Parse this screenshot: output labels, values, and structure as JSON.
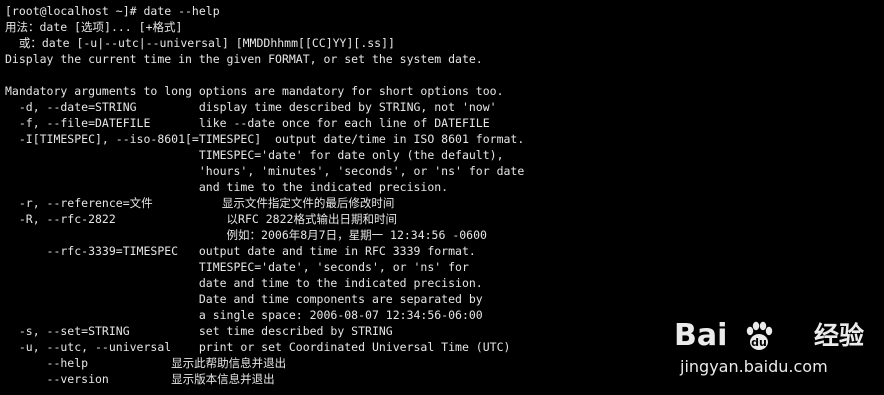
{
  "terminal": {
    "lines": [
      "[root@localhost ~]# date --help",
      "用法：date [选项]... [+格式]",
      "  或：date [-u|--utc|--universal] [MMDDhhmm[[CC]YY][.ss]]",
      "Display the current time in the given FORMAT, or set the system date.",
      "",
      "Mandatory arguments to long options are mandatory for short options too.",
      "  -d, --date=STRING         display time described by STRING, not 'now'",
      "  -f, --file=DATEFILE       like --date once for each line of DATEFILE",
      "  -I[TIMESPEC], --iso-8601[=TIMESPEC]  output date/time in ISO 8601 format.",
      "                            TIMESPEC='date' for date only (the default),",
      "                            'hours', 'minutes', 'seconds', or 'ns' for date",
      "                            and time to the indicated precision.",
      "  -r, --reference=文件          显示文件指定文件的最后修改时间",
      "  -R, --rfc-2822                以RFC 2822格式输出日期和时间",
      "                                例如：2006年8月7日，星期一 12:34:56 -0600",
      "      --rfc-3339=TIMESPEC   output date and time in RFC 3339 format.",
      "                            TIMESPEC='date', 'seconds', or 'ns' for",
      "                            date and time to the indicated precision.",
      "                            Date and time components are separated by",
      "                            a single space: 2006-08-07 12:34:56-06:00",
      "  -s, --set=STRING          set time described by STRING",
      "  -u, --utc, --universal    print or set Coordinated Universal Time (UTC)",
      "      --help            显示此帮助信息并退出",
      "      --version         显示版本信息并退出"
    ]
  },
  "watermark": {
    "logo": "Bai du",
    "site_name": "经验",
    "url": "jingyan.baidu.com",
    "paw_icon": "baidu-paw-icon"
  },
  "colors": {
    "background": "#000000",
    "text": "#e6e6e6",
    "watermark": "#ffffff"
  }
}
